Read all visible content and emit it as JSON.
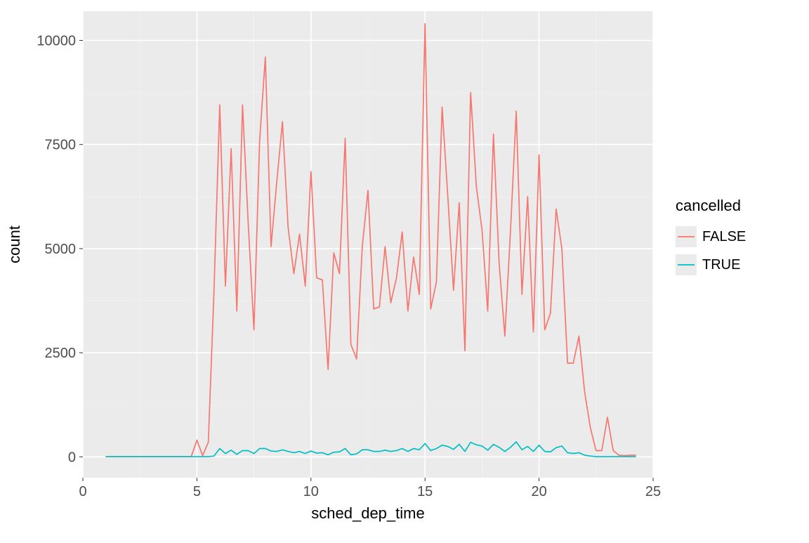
{
  "chart_data": {
    "type": "line",
    "xlabel": "sched_dep_time",
    "ylabel": "count",
    "xlim": [
      0,
      25
    ],
    "ylim": [
      -500,
      10700
    ],
    "x_ticks": [
      0,
      5,
      10,
      15,
      20,
      25
    ],
    "y_ticks": [
      0,
      2500,
      5000,
      7500,
      10000
    ],
    "legend_title": "cancelled",
    "colors": {
      "FALSE": "#F8766D",
      "TRUE": "#00BFC4"
    },
    "x": [
      1,
      1.25,
      1.5,
      1.75,
      2,
      2.25,
      2.5,
      2.75,
      3,
      3.25,
      3.5,
      3.75,
      4,
      4.25,
      4.5,
      4.75,
      5,
      5.25,
      5.5,
      5.75,
      6,
      6.25,
      6.5,
      6.75,
      7,
      7.25,
      7.5,
      7.75,
      8,
      8.25,
      8.5,
      8.75,
      9,
      9.25,
      9.5,
      9.75,
      10,
      10.25,
      10.5,
      10.75,
      11,
      11.25,
      11.5,
      11.75,
      12,
      12.25,
      12.5,
      12.75,
      13,
      13.25,
      13.5,
      13.75,
      14,
      14.25,
      14.5,
      14.75,
      15,
      15.25,
      15.5,
      15.75,
      16,
      16.25,
      16.5,
      16.75,
      17,
      17.25,
      17.5,
      17.75,
      18,
      18.25,
      18.5,
      18.75,
      19,
      19.25,
      19.5,
      19.75,
      20,
      20.25,
      20.5,
      20.75,
      21,
      21.25,
      21.5,
      21.75,
      22,
      22.25,
      22.5,
      22.75,
      23,
      23.25,
      23.5,
      23.75,
      24,
      24.25
    ],
    "series": [
      {
        "name": "FALSE",
        "values": [
          5,
          5,
          5,
          5,
          5,
          5,
          5,
          5,
          5,
          5,
          5,
          5,
          5,
          5,
          5,
          5,
          400,
          30,
          350,
          4000,
          8450,
          4100,
          7400,
          3500,
          8450,
          5600,
          3050,
          7600,
          9600,
          5050,
          6600,
          8050,
          5500,
          4400,
          5350,
          4100,
          6850,
          4300,
          4250,
          2100,
          4900,
          4400,
          7650,
          2700,
          2350,
          5050,
          6400,
          3550,
          3600,
          5050,
          3700,
          4300,
          5400,
          3500,
          4800,
          3900,
          10400,
          3550,
          4200,
          8400,
          6250,
          4000,
          6100,
          2550,
          8750,
          6500,
          5450,
          3500,
          7750,
          4650,
          2900,
          5450,
          8300,
          3900,
          6250,
          3000,
          7250,
          3050,
          3450,
          5950,
          5000,
          2250,
          2250,
          2900,
          1550,
          700,
          150,
          150,
          950,
          150,
          40,
          30,
          40,
          40
        ]
      },
      {
        "name": "TRUE",
        "values": [
          5,
          5,
          5,
          5,
          5,
          5,
          5,
          5,
          5,
          5,
          5,
          5,
          5,
          5,
          5,
          5,
          5,
          5,
          5,
          20,
          200,
          80,
          160,
          60,
          150,
          150,
          80,
          200,
          200,
          140,
          130,
          170,
          130,
          100,
          130,
          80,
          140,
          90,
          100,
          50,
          110,
          120,
          200,
          50,
          70,
          170,
          170,
          130,
          130,
          160,
          130,
          150,
          200,
          130,
          200,
          170,
          320,
          150,
          200,
          280,
          250,
          180,
          300,
          130,
          350,
          290,
          260,
          160,
          300,
          230,
          130,
          230,
          360,
          170,
          250,
          130,
          280,
          130,
          120,
          220,
          260,
          100,
          80,
          100,
          40,
          20,
          5,
          5,
          5,
          5,
          5,
          5,
          5,
          5
        ]
      }
    ]
  },
  "legend": {
    "items": [
      "FALSE",
      "TRUE"
    ]
  }
}
